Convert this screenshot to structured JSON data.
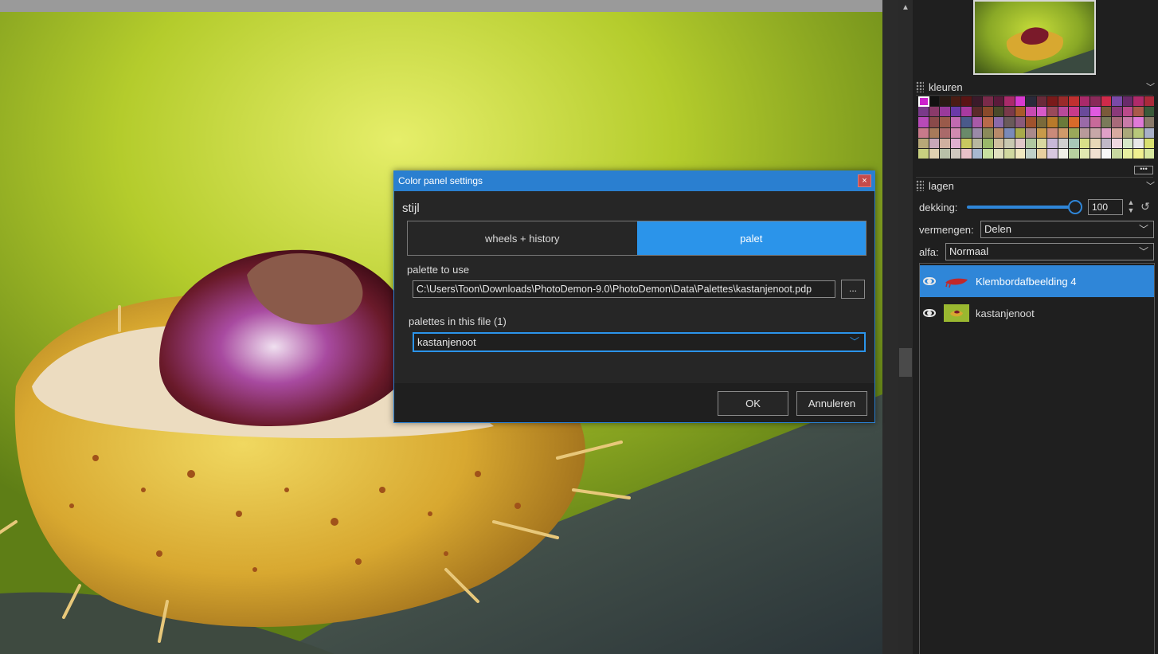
{
  "canvas": {
    "image_name": "kastanjenoot"
  },
  "colors_panel": {
    "title": "kleuren",
    "more_label": "•••",
    "swatches": [
      "#cc22cc",
      "#111111",
      "#2a1a14",
      "#4a1c14",
      "#5a1414",
      "#3a1a2a",
      "#7a2a4a",
      "#5a1a3a",
      "#aa2a6a",
      "#d83ad0",
      "#2a2a3a",
      "#6a2a3a",
      "#7a1a1a",
      "#9a2a2a",
      "#c03030",
      "#aa2a6a",
      "#8a2a5a",
      "#d02a4a",
      "#7a4aa8",
      "#6a2a6a",
      "#b02a6a",
      "#aa2a3a",
      "#7a3a8a",
      "#8a3a6a",
      "#9a3a9a",
      "#6a3aa8",
      "#a83aa0",
      "#5a2a2a",
      "#8a4a2a",
      "#4a4a2a",
      "#7a3a4a",
      "#a85a2a",
      "#c84ab0",
      "#d85ac8",
      "#9a4a5a",
      "#b84a9a",
      "#c83a8a",
      "#6a4a9a",
      "#e05ae0",
      "#7a5a3a",
      "#8a3a7a",
      "#ba4a8a",
      "#aa5a4a",
      "#3a5a3a",
      "#b84ab8",
      "#8a4a4a",
      "#9a5a4a",
      "#c06ab0",
      "#4a5a8a",
      "#a85aa8",
      "#b86a4a",
      "#8a6aaa",
      "#6a5a5a",
      "#8a5a7a",
      "#a0522d",
      "#7a6a3a",
      "#b87a2a",
      "#6a7a3a",
      "#d86a2a",
      "#9a6aa8",
      "#c86a9a",
      "#7a7a5a",
      "#a86a7a",
      "#c87aa8",
      "#e07ad8",
      "#8a7a6a",
      "#c87a8a",
      "#a87a5a",
      "#aa6a6a",
      "#d08ab0",
      "#6a8a6a",
      "#9a8aa8",
      "#8a8a5a",
      "#b88a6a",
      "#7a8ab8",
      "#a8aa4a",
      "#aa8a8a",
      "#c89a4a",
      "#ca8a7a",
      "#d09a6a",
      "#9aa85a",
      "#b89a9a",
      "#c8a8a8",
      "#e0a0c8",
      "#d8aaa0",
      "#aaa87a",
      "#b8c87a",
      "#a8b0c8",
      "#b8a878",
      "#c8a8b8",
      "#d0b0a0",
      "#e0b0d0",
      "#c8c860",
      "#b8b8a0",
      "#9ab86a",
      "#d0c0a0",
      "#c8c8b0",
      "#e0c8c8",
      "#b0c8a0",
      "#d8d8a0",
      "#c8b8d8",
      "#d0d0d0",
      "#a8c8b8",
      "#d8e088",
      "#e8d8b8",
      "#c0b8c8",
      "#f0d8e0",
      "#d8e8c8",
      "#e8e8e8",
      "#d8e070",
      "#c8d080",
      "#e0d0b0",
      "#b8c0a8",
      "#d0c8c0",
      "#e8c0c8",
      "#a8b8d0",
      "#c8e0a0",
      "#e0e0c0",
      "#d0d8a0",
      "#f0e8c0",
      "#c0d0c8",
      "#e8d0a0",
      "#d8c8e0",
      "#f0f0e8",
      "#b8d0a0",
      "#e0e8b0",
      "#f0e0d0",
      "#f8f8f8",
      "#c8d8a0",
      "#e8f0a0",
      "#f0f090",
      "#d8e8a0"
    ]
  },
  "layers_panel": {
    "title": "lagen",
    "opacity_label": "dekking:",
    "opacity_value": "100",
    "opacity_fraction": 1.0,
    "blend_label": "vermengen:",
    "blend_value": "Delen",
    "alpha_label": "alfa:",
    "alpha_value": "Normaal",
    "layers": [
      {
        "name": "Klembordafbeelding 4",
        "active": true,
        "thumb_color": "#c0282a"
      },
      {
        "name": "kastanjenoot",
        "active": false,
        "thumb_color": "#9ab830"
      }
    ]
  },
  "dialog": {
    "title": "Color panel settings",
    "close_label": "×",
    "style_label": "stijl",
    "style_options": [
      "wheels + history",
      "palet"
    ],
    "style_selected": "palet",
    "palette_to_use_label": "palette to use",
    "palette_path": "C:\\Users\\Toon\\Downloads\\PhotoDemon-9.0\\PhotoDemon\\Data\\Palettes\\kastanjenoot.pdp",
    "browse_label": "...",
    "palettes_in_file_label": "palettes in this file (1)",
    "palette_selected": "kastanjenoot",
    "ok_label": "OK",
    "cancel_label": "Annuleren"
  },
  "colors": {
    "accent": "#2b94ea",
    "title_bar": "#2a7fd0",
    "panel_bg": "#1f1f1f",
    "dialog_bg": "#262626",
    "close_red": "#c44b4b"
  }
}
